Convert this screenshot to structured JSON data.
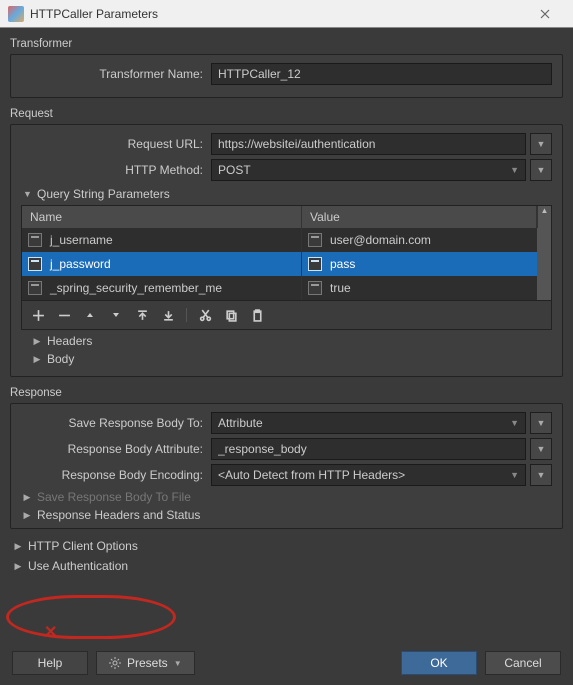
{
  "window": {
    "title": "HTTPCaller Parameters"
  },
  "transformer": {
    "section_label": "Transformer",
    "name_label": "Transformer Name:",
    "name_value": "HTTPCaller_12"
  },
  "request": {
    "section_label": "Request",
    "url_label": "Request URL:",
    "url_value": "https://websitei/authentication",
    "method_label": "HTTP Method:",
    "method_value": "POST",
    "query_params_label": "Query String Parameters",
    "table": {
      "col_name": "Name",
      "col_value": "Value",
      "rows": [
        {
          "name": "j_username",
          "value": "user@domain.com",
          "selected": false
        },
        {
          "name": "j_password",
          "value": "pass",
          "selected": true
        },
        {
          "name": "_spring_security_remember_me",
          "value": "true",
          "selected": false
        }
      ]
    },
    "headers_label": "Headers",
    "body_label": "Body"
  },
  "response": {
    "section_label": "Response",
    "save_body_to_label": "Save Response Body To:",
    "save_body_to_value": "Attribute",
    "body_attr_label": "Response Body Attribute:",
    "body_attr_value": "_response_body",
    "body_enc_label": "Response Body Encoding:",
    "body_enc_value": "<Auto Detect from HTTP Headers>",
    "save_to_file_label": "Save Response Body To File",
    "headers_status_label": "Response Headers and Status"
  },
  "http_client": {
    "label": "HTTP Client Options"
  },
  "use_auth": {
    "label": "Use Authentication"
  },
  "footer": {
    "help": "Help",
    "presets": "Presets",
    "ok": "OK",
    "cancel": "Cancel"
  }
}
